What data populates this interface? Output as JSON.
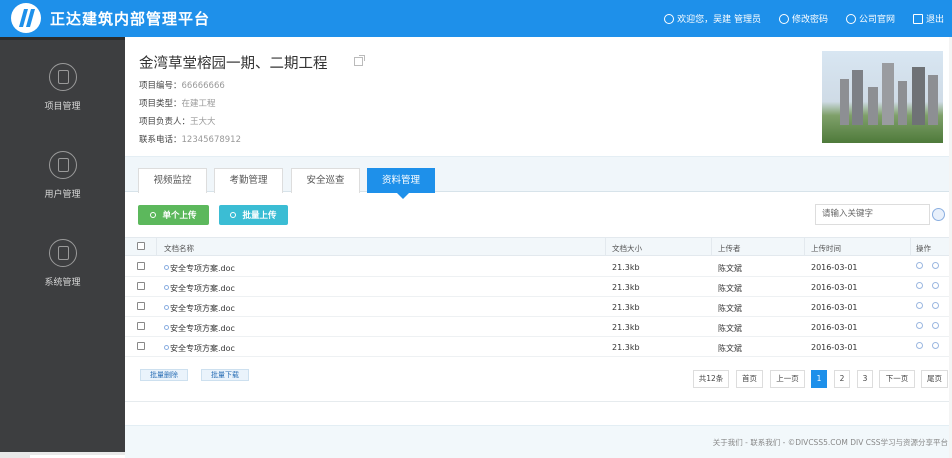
{
  "header": {
    "app_title": "正达建筑内部管理平台",
    "greeting": "欢迎您，吴建 管理员",
    "change_password": "修改密码",
    "official_site": "公司官网",
    "logout": "退出"
  },
  "sidebar": {
    "items": [
      {
        "label": "项目管理"
      },
      {
        "label": "用户管理"
      },
      {
        "label": "系统管理"
      }
    ]
  },
  "project": {
    "title": "金湾草堂榕园一期、二期工程",
    "fields": [
      {
        "label": "项目编号：",
        "value": "66666666"
      },
      {
        "label": "项目类型：",
        "value": "在建工程"
      },
      {
        "label": "项目负责人：",
        "value": "王大大"
      },
      {
        "label": "联系电话：",
        "value": "12345678912"
      }
    ]
  },
  "tabs": [
    {
      "label": "视频监控"
    },
    {
      "label": "考勤管理"
    },
    {
      "label": "安全巡查"
    },
    {
      "label": "资料管理"
    }
  ],
  "actions": {
    "single_upload": "单个上传",
    "batch_upload": "批量上传",
    "search_placeholder": "请输入关键字"
  },
  "table": {
    "headers": {
      "name": "文档名称",
      "size": "文档大小",
      "uploader": "上传者",
      "time": "上传时间",
      "ops": "操作"
    },
    "rows": [
      {
        "name": "安全专项方案.doc",
        "size": "21.3kb",
        "uploader": "陈文斌",
        "time": "2016-03-01"
      },
      {
        "name": "安全专项方案.doc",
        "size": "21.3kb",
        "uploader": "陈文斌",
        "time": "2016-03-01"
      },
      {
        "name": "安全专项方案.doc",
        "size": "21.3kb",
        "uploader": "陈文斌",
        "time": "2016-03-01"
      },
      {
        "name": "安全专项方案.doc",
        "size": "21.3kb",
        "uploader": "陈文斌",
        "time": "2016-03-01"
      },
      {
        "name": "安全专项方案.doc",
        "size": "21.3kb",
        "uploader": "陈文斌",
        "time": "2016-03-01"
      }
    ]
  },
  "bulk": {
    "delete": "批量删除",
    "download": "批量下载"
  },
  "pagination": {
    "total": "共12条",
    "first": "首页",
    "prev": "上一页",
    "pages": [
      "1",
      "2",
      "3"
    ],
    "current": "1",
    "next": "下一页",
    "last": "尾页"
  },
  "footer": {
    "text": "关于我们 - 联系我们 - ©DIVCSS5.COM DIV CSS学习与资源分享平台"
  },
  "colors": {
    "primary": "#1e90ea",
    "sidebar": "#3d3e40",
    "single_upload": "#5cb85c",
    "batch_upload": "#3bbdd4"
  }
}
